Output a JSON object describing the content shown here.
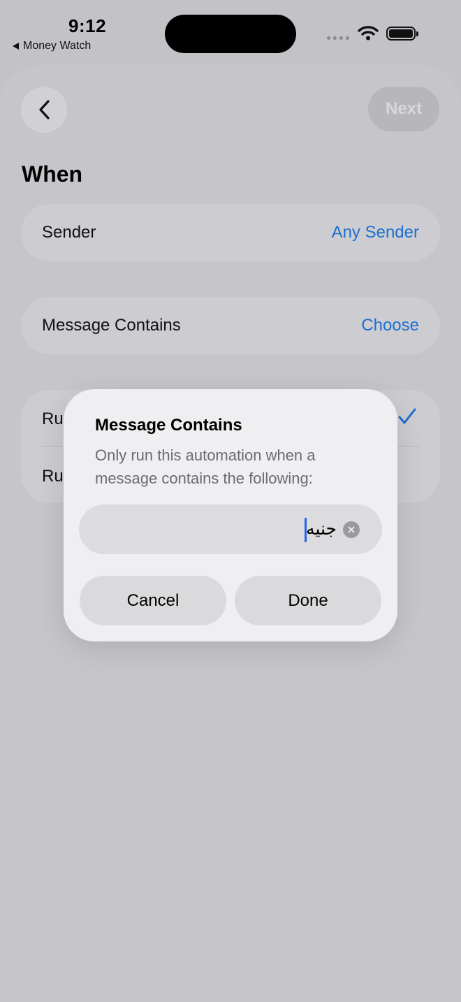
{
  "status_bar": {
    "time": "9:12",
    "back_app": "Money Watch"
  },
  "nav": {
    "next_label": "Next"
  },
  "section": {
    "title": "When"
  },
  "rows": [
    {
      "label": "Sender",
      "value": "Any Sender"
    },
    {
      "label": "Message Contains",
      "value": "Choose"
    }
  ],
  "run_options": [
    {
      "label": "Ru",
      "checked": true
    },
    {
      "label": "Ru",
      "checked": false
    }
  ],
  "dialog": {
    "title": "Message Contains",
    "message": "Only run this automation when a message contains the following:",
    "input_value": "جنيه",
    "cancel_label": "Cancel",
    "done_label": "Done"
  },
  "colors": {
    "accent": "#1e6fd0",
    "caret": "#2563eb"
  }
}
